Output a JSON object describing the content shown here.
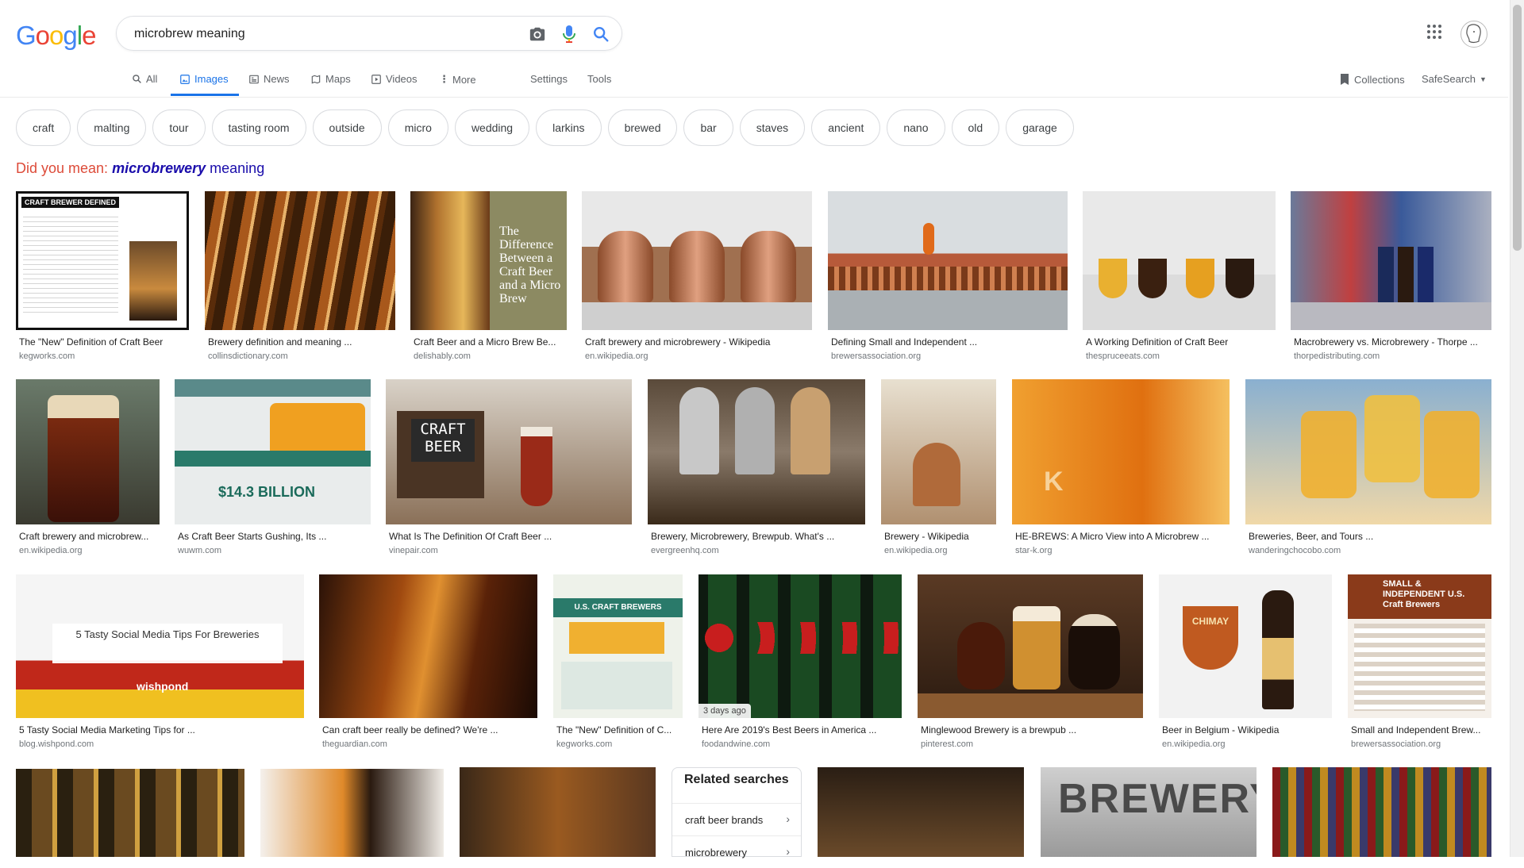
{
  "logo": {
    "text": "Google"
  },
  "search": {
    "value": "microbrew meaning"
  },
  "tabs": {
    "all": "All",
    "images": "Images",
    "news": "News",
    "maps": "Maps",
    "videos": "Videos",
    "more": "More",
    "settings": "Settings",
    "tools": "Tools",
    "collections": "Collections",
    "safesearch": "SafeSearch"
  },
  "chips": [
    "craft",
    "malting",
    "tour",
    "tasting room",
    "outside",
    "micro",
    "wedding",
    "larkins",
    "brewed",
    "bar",
    "staves",
    "ancient",
    "nano",
    "old",
    "garage"
  ],
  "did_you_mean": {
    "prefix": "Did you mean:",
    "bold": "microbrewery",
    "rest": "meaning"
  },
  "results": [
    {
      "caption": "The \"New\" Definition of Craft Beer",
      "source": "kegworks.com",
      "overlay": "CRAFT BREWER DEFINED"
    },
    {
      "caption": "Brewery definition and meaning ...",
      "source": "collinsdictionary.com"
    },
    {
      "caption": "Craft Beer and a Micro Brew Be...",
      "source": "delishably.com",
      "overlay": "The Difference Between a Craft Beer and a Micro Brew"
    },
    {
      "caption": "Craft brewery and microbrewery - Wikipedia",
      "source": "en.wikipedia.org"
    },
    {
      "caption": "Defining Small and Independent ...",
      "source": "brewersassociation.org"
    },
    {
      "caption": "A Working Definition of Craft Beer",
      "source": "thespruceeats.com"
    },
    {
      "caption": "Macrobrewery vs. Microbrewery - Thorpe ...",
      "source": "thorpedistributing.com"
    },
    {
      "caption": "Craft brewery and microbrew...",
      "source": "en.wikipedia.org"
    },
    {
      "caption": "As Craft Beer Starts Gushing, Its ...",
      "source": "wuwm.com",
      "overlay": "$14.3 BILLION"
    },
    {
      "caption": "What Is The Definition Of Craft Beer ...",
      "source": "vinepair.com",
      "overlay": "CRAFT BEER"
    },
    {
      "caption": "Brewery, Microbrewery, Brewpub. What's ...",
      "source": "evergreenhq.com"
    },
    {
      "caption": "Brewery - Wikipedia",
      "source": "en.wikipedia.org"
    },
    {
      "caption": "HE-BREWS: A Micro View into A Microbrew ...",
      "source": "star-k.org",
      "overlay": "K"
    },
    {
      "caption": "Breweries, Beer, and Tours ...",
      "source": "wanderingchocobo.com"
    },
    {
      "caption": "5 Tasty Social Media Marketing Tips for ...",
      "source": "blog.wishpond.com",
      "overlay": "5 Tasty Social Media Tips For Breweries",
      "overlay2": "wishpond"
    },
    {
      "caption": "Can craft beer really be defined? We're ...",
      "source": "theguardian.com"
    },
    {
      "caption": "The \"New\" Definition of C...",
      "source": "kegworks.com",
      "overlay": "U.S. CRAFT BREWERS"
    },
    {
      "caption": "Here Are 2019's Best Beers in America ...",
      "source": "foodandwine.com",
      "badge": "3 days ago"
    },
    {
      "caption": "Minglewood Brewery is a brewpub ...",
      "source": "pinterest.com"
    },
    {
      "caption": "Beer in Belgium - Wikipedia",
      "source": "en.wikipedia.org",
      "overlay": "CHIMAY"
    },
    {
      "caption": "Small and Independent Brew...",
      "source": "brewersassociation.org",
      "overlay": "SMALL & INDEPENDENT U.S. Craft Brewers"
    }
  ],
  "bottom_overlay": "BREWERY",
  "related": {
    "title": "Related searches",
    "items": [
      "craft beer brands",
      "microbrewery"
    ]
  },
  "colors": {
    "accent": "#1a73e8",
    "did_you_mean": "#dd4b39",
    "link": "#1a0dab"
  }
}
